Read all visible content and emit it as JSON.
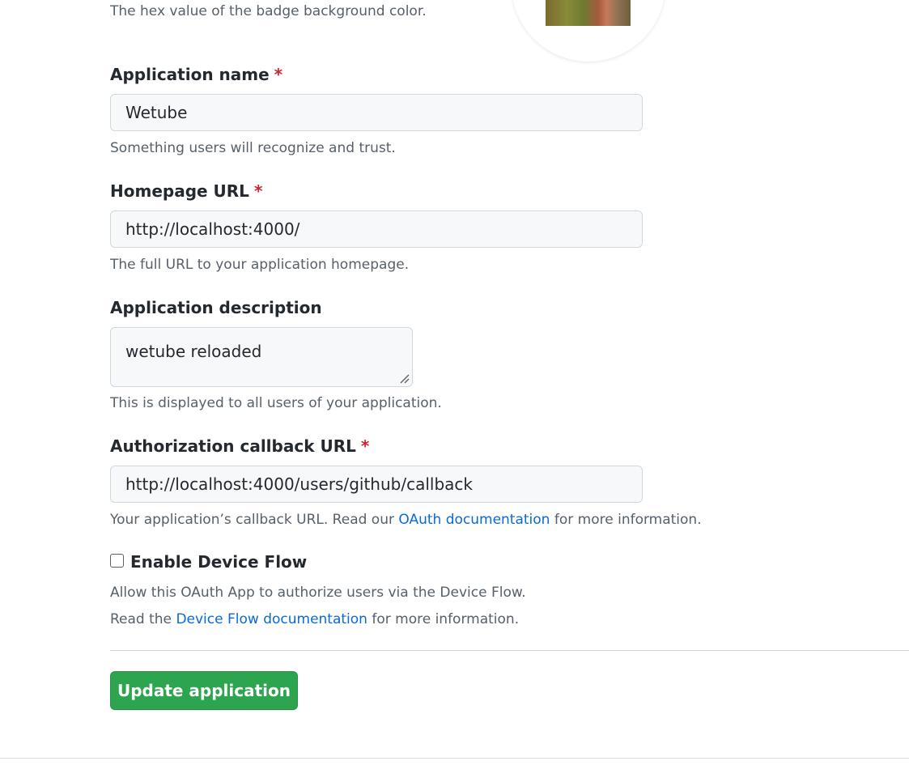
{
  "badge_color": {
    "hint": "The hex value of the badge background color."
  },
  "app_name": {
    "label": "Application name",
    "required_mark": "*",
    "value": "Wetube",
    "hint": "Something users will recognize and trust."
  },
  "homepage": {
    "label": "Homepage URL",
    "required_mark": "*",
    "value": "http://localhost:4000/",
    "hint": "The full URL to your application homepage."
  },
  "description": {
    "label": "Application description",
    "value": "wetube reloaded",
    "hint": "This is displayed to all users of your application."
  },
  "callback": {
    "label": "Authorization callback URL",
    "required_mark": "*",
    "value": "http://localhost:4000/users/github/callback",
    "hint_prefix": "Your application’s callback URL. Read our ",
    "hint_link": "OAuth documentation",
    "hint_suffix": " for more information."
  },
  "device_flow": {
    "label": "Enable Device Flow",
    "checked": false,
    "hint_line1": "Allow this OAuth App to authorize users via the Device Flow.",
    "hint_line2_prefix": "Read the ",
    "hint_line2_link": "Device Flow documentation",
    "hint_line2_suffix": " for more information."
  },
  "submit": {
    "label": "Update application",
    "color": "#2da44e"
  },
  "colors": {
    "link": "#0969da",
    "required": "#cf222e",
    "muted": "#57606a",
    "text": "#24292f"
  }
}
